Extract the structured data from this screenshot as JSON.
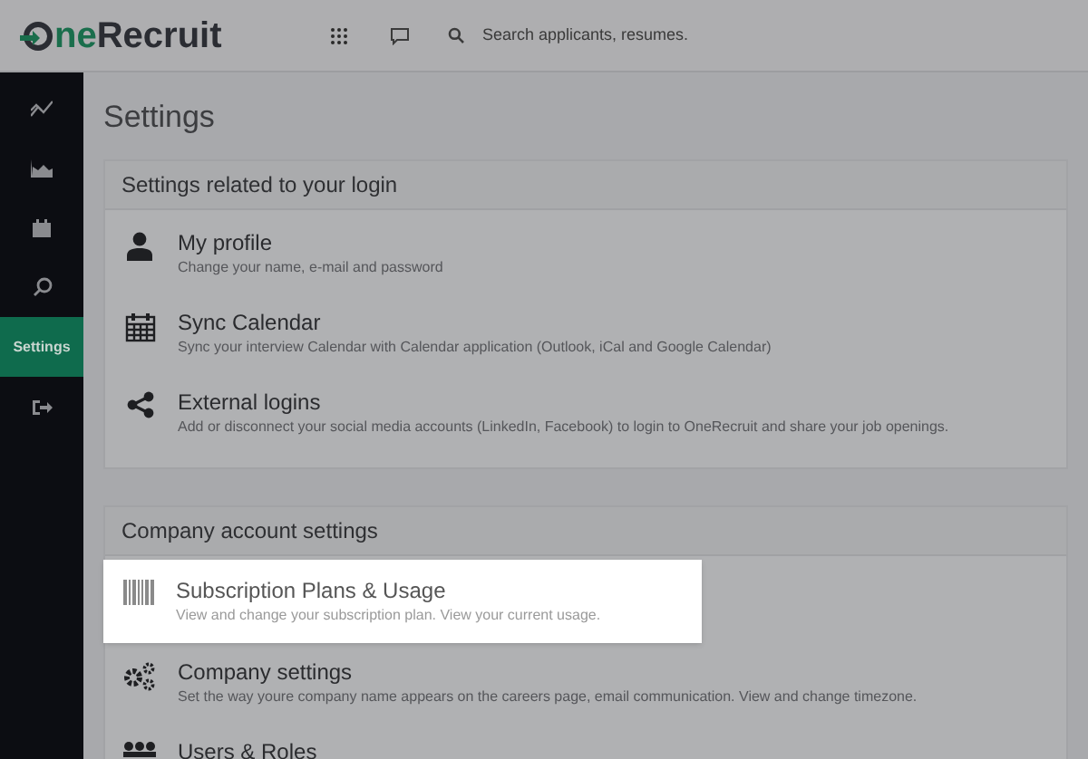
{
  "topbar": {
    "logo_prefix": "ne",
    "logo_suffix": "Recruit",
    "search": {
      "placeholder": "Search applicants, resumes."
    }
  },
  "sidebar": {
    "items": [
      {
        "kind": "line",
        "selected": false
      },
      {
        "kind": "area",
        "selected": false
      },
      {
        "kind": "calendar",
        "selected": false
      },
      {
        "kind": "search",
        "selected": false
      },
      {
        "kind": "label",
        "label": "Settings",
        "selected": true
      },
      {
        "kind": "logout",
        "selected": false
      }
    ]
  },
  "page_title": "Settings",
  "sections": [
    {
      "title": "Settings related to your login",
      "items": [
        {
          "kind": "user",
          "title": "My profile",
          "description": "Change your name, e-mail and password",
          "highlighted": false
        },
        {
          "kind": "calendar",
          "title": "Sync Calendar",
          "description": "Sync your interview Calendar with Calendar application (Outlook, iCal and Google Calendar)",
          "highlighted": false
        },
        {
          "kind": "share",
          "title": "External logins",
          "description": "Add or disconnect your social media accounts (LinkedIn, Facebook) to login to OneRecruit and share your job openings.",
          "highlighted": false
        }
      ]
    },
    {
      "title": "Company account settings",
      "items": [
        {
          "kind": "barcode",
          "title": "Subscription Plans & Usage",
          "description": "View and change your subscription plan. View your current usage.",
          "highlighted": true
        },
        {
          "kind": "gears",
          "title": "Company settings",
          "description": "Set the way youre company name appears on the careers page, email communication. View and change timezone.",
          "highlighted": false
        },
        {
          "kind": "users",
          "title": "Users & Roles",
          "highlighted": false
        }
      ]
    }
  ]
}
